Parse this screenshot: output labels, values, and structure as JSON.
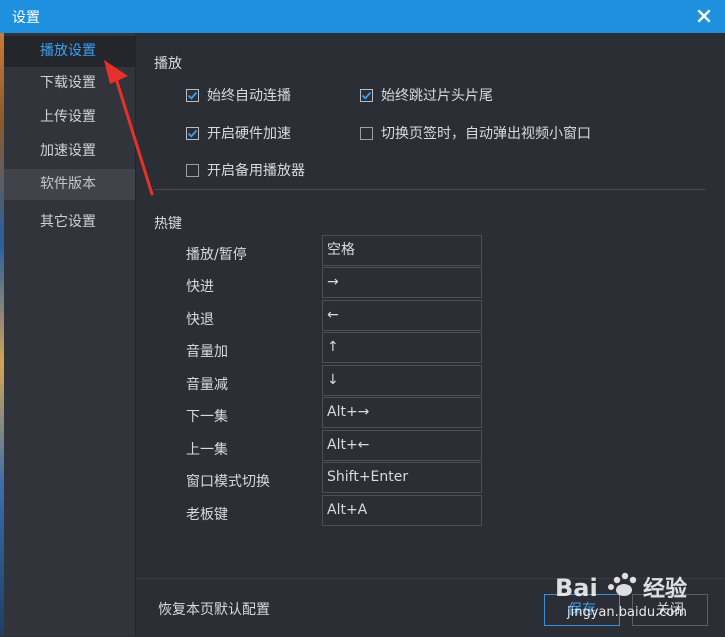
{
  "window": {
    "title": "设置",
    "close_icon": "close-icon",
    "accent": "#1f8fe0"
  },
  "sidebar": {
    "items": [
      {
        "label": "播放设置",
        "state": "active"
      },
      {
        "label": "下载设置",
        "state": "normal"
      },
      {
        "label": "上传设置",
        "state": "normal"
      },
      {
        "label": "加速设置",
        "state": "normal"
      },
      {
        "label": "软件版本",
        "state": "muted"
      },
      {
        "label": "其它设置",
        "state": "normal"
      }
    ]
  },
  "playback": {
    "section_title": "播放",
    "options": [
      {
        "label": "始终自动连播",
        "checked": true
      },
      {
        "label": "始终跳过片头片尾",
        "checked": true
      },
      {
        "label": "开启硬件加速",
        "checked": true
      },
      {
        "label": "切换页签时，自动弹出视频小窗口",
        "checked": false
      },
      {
        "label": "开启备用播放器",
        "checked": false
      }
    ]
  },
  "hotkeys": {
    "section_title": "热键",
    "rows": [
      {
        "label": "播放/暂停",
        "value": "空格"
      },
      {
        "label": "快进",
        "value": "→"
      },
      {
        "label": "快退",
        "value": "←"
      },
      {
        "label": "音量加",
        "value": "↑"
      },
      {
        "label": "音量减",
        "value": "↓"
      },
      {
        "label": "下一集",
        "value": "Alt+→"
      },
      {
        "label": "上一集",
        "value": "Alt+←"
      },
      {
        "label": "窗口模式切换",
        "value": "Shift+Enter"
      },
      {
        "label": "老板键",
        "value": "Alt+A"
      }
    ]
  },
  "footer": {
    "restore_label": "恢复本页默认配置",
    "save_label": "保存",
    "close_label": "关闭"
  },
  "watermark": {
    "brand": "Bai",
    "brand_suffix": "经验",
    "url": "jingyan.baidu.com"
  }
}
